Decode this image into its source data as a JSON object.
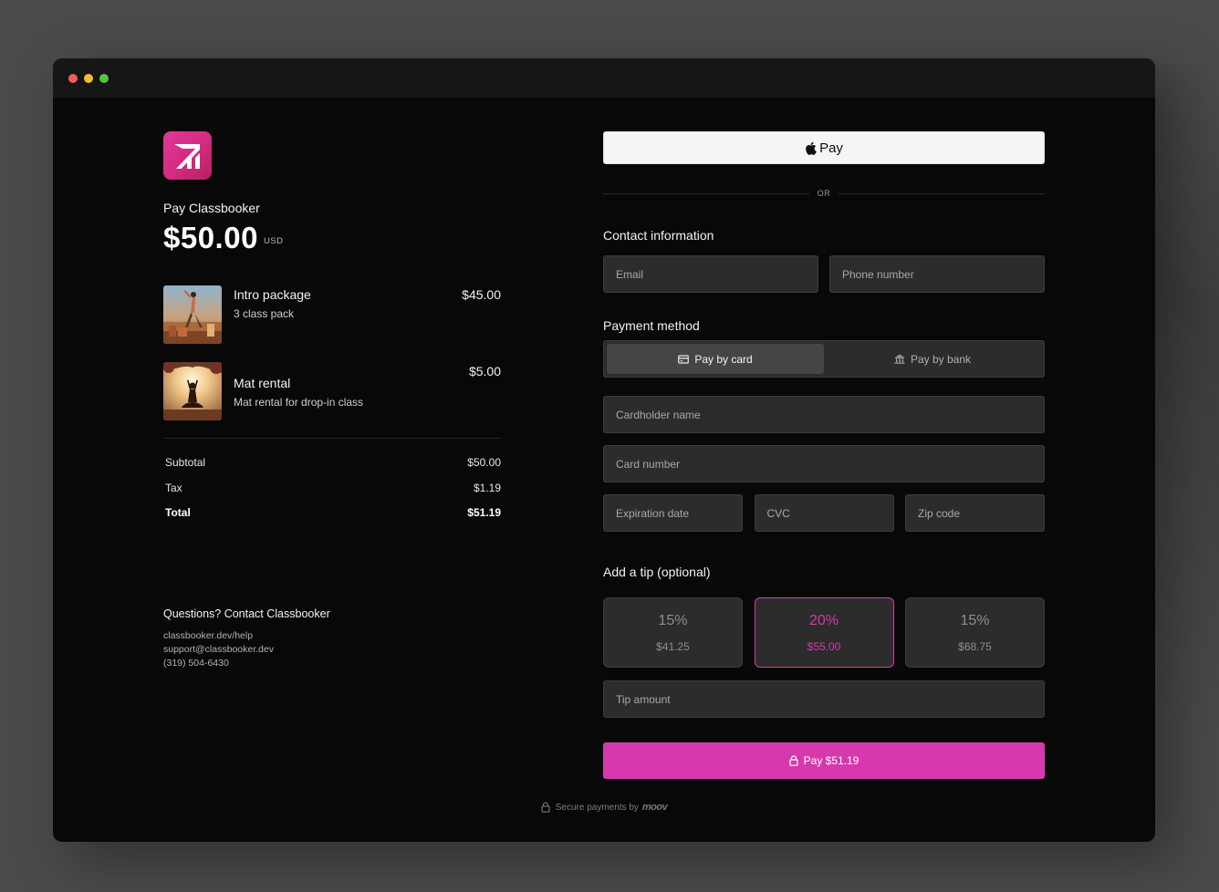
{
  "colors": {
    "accent": "#d639ad",
    "brand_logo": "#e3379b",
    "background": "#080808",
    "field": "#2c2c2c"
  },
  "merchant": {
    "label": "Pay Classbooker",
    "amount": "$50.00",
    "currency": "USD",
    "logo_icon": "classbooker-logo-icon"
  },
  "items": [
    {
      "name": "Intro package",
      "description": "3 class pack",
      "price": "$45.00",
      "image": "yoga-group-photo"
    },
    {
      "name": "Mat rental",
      "description": "Mat rental for drop-in class",
      "price": "$5.00",
      "image": "meditation-silhouette-photo"
    }
  ],
  "totals": {
    "subtotal_label": "Subtotal",
    "subtotal": "$50.00",
    "tax_label": "Tax",
    "tax": "$1.19",
    "total_label": "Total",
    "total": "$51.19"
  },
  "contact": {
    "title": "Questions? Contact Classbooker",
    "help_url": "classbooker.dev/help",
    "email": "support@classbooker.dev",
    "phone": "(319) 504-6430"
  },
  "apple_pay": {
    "label": "Pay",
    "icon": "apple-icon"
  },
  "or_label": "OR",
  "contact_info": {
    "title": "Contact information",
    "email_placeholder": "Email",
    "phone_placeholder": "Phone number"
  },
  "payment_method": {
    "title": "Payment method",
    "options": [
      {
        "label": "Pay by card",
        "icon": "credit-card-icon",
        "selected": true
      },
      {
        "label": "Pay by bank",
        "icon": "bank-icon",
        "selected": false
      }
    ]
  },
  "card": {
    "name_placeholder": "Cardholder name",
    "number_placeholder": "Card number",
    "expiry_placeholder": "Expiration date",
    "cvc_placeholder": "CVC",
    "zip_placeholder": "Zip code"
  },
  "tip": {
    "title": "Add a tip (optional)",
    "options": [
      {
        "percent": "15%",
        "amount": "$41.25",
        "selected": false
      },
      {
        "percent": "20%",
        "amount": "$55.00",
        "selected": true
      },
      {
        "percent": "15%",
        "amount": "$68.75",
        "selected": false
      }
    ],
    "amount_placeholder": "Tip amount"
  },
  "pay_button": {
    "label": "Pay $51.19",
    "icon": "lock-icon"
  },
  "footer": {
    "secure_label": "Secure payments by",
    "brand": "moov",
    "icon": "lock-icon"
  }
}
